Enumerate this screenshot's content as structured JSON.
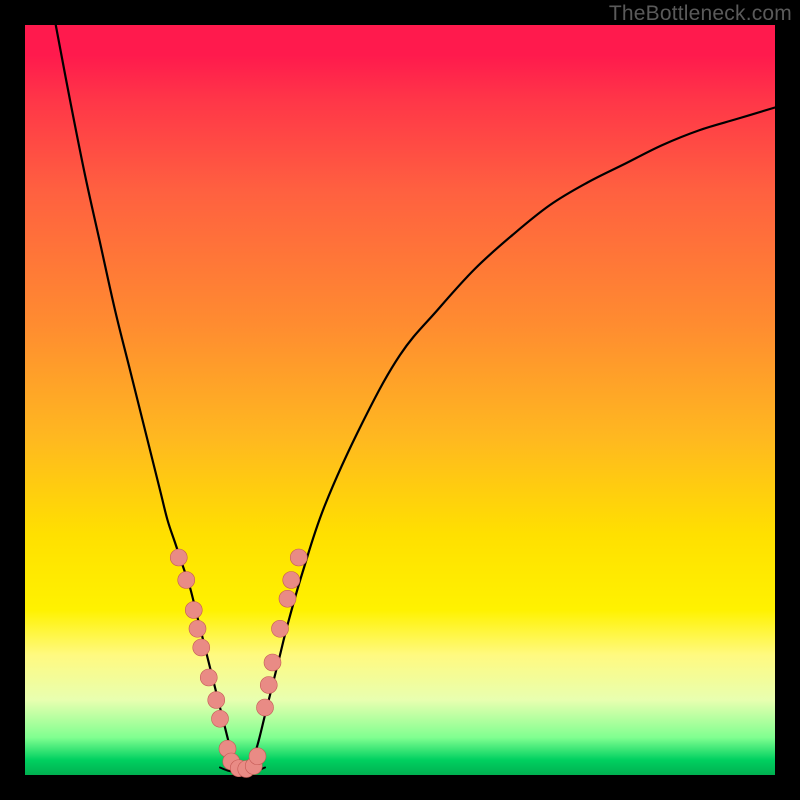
{
  "watermark": "TheBottleneck.com",
  "chart_data": {
    "type": "line",
    "title": "",
    "xlabel": "",
    "ylabel": "",
    "xlim": [
      0,
      100
    ],
    "ylim": [
      0,
      100
    ],
    "grid": false,
    "gradient_stops": [
      {
        "offset": 0,
        "color": "#ff1a4d"
      },
      {
        "offset": 4,
        "color": "#ff1a4d"
      },
      {
        "offset": 10,
        "color": "#ff3648"
      },
      {
        "offset": 22,
        "color": "#ff6040"
      },
      {
        "offset": 40,
        "color": "#ff8c30"
      },
      {
        "offset": 55,
        "color": "#ffb820"
      },
      {
        "offset": 68,
        "color": "#ffe000"
      },
      {
        "offset": 78,
        "color": "#fff200"
      },
      {
        "offset": 84,
        "color": "#fffa80"
      },
      {
        "offset": 90,
        "color": "#e8ffb0"
      },
      {
        "offset": 95,
        "color": "#80ff90"
      },
      {
        "offset": 98,
        "color": "#00d060"
      },
      {
        "offset": 100,
        "color": "#00b050"
      }
    ],
    "series": [
      {
        "name": "left-curve",
        "x": [
          4.1,
          6,
          8,
          10,
          12,
          14,
          16,
          18,
          19,
          20,
          21,
          22,
          23,
          24,
          25,
          26,
          27,
          28
        ],
        "y": [
          100,
          90,
          80,
          71,
          62,
          54,
          46,
          38,
          34,
          31,
          28,
          25,
          21,
          17,
          13,
          9,
          5,
          1
        ]
      },
      {
        "name": "right-curve",
        "x": [
          30,
          31,
          32,
          33,
          34,
          35,
          37,
          40,
          45,
          50,
          55,
          60,
          65,
          70,
          75,
          80,
          85,
          90,
          95,
          100
        ],
        "y": [
          1,
          4,
          8,
          12,
          16,
          20,
          27,
          36,
          47,
          56,
          62,
          67.5,
          72,
          76,
          79,
          81.5,
          84,
          86,
          87.5,
          89
        ]
      },
      {
        "name": "valley-floor",
        "x": [
          26,
          27,
          28,
          29,
          30,
          31,
          32
        ],
        "y": [
          1,
          0.6,
          0.4,
          0.3,
          0.4,
          0.6,
          1
        ]
      }
    ],
    "markers": [
      {
        "x": 20.5,
        "y": 29
      },
      {
        "x": 21.5,
        "y": 26
      },
      {
        "x": 22.5,
        "y": 22
      },
      {
        "x": 23,
        "y": 19.5
      },
      {
        "x": 23.5,
        "y": 17
      },
      {
        "x": 24.5,
        "y": 13
      },
      {
        "x": 25.5,
        "y": 10
      },
      {
        "x": 26,
        "y": 7.5
      },
      {
        "x": 27,
        "y": 3.5
      },
      {
        "x": 27.5,
        "y": 1.8
      },
      {
        "x": 28.5,
        "y": 0.9
      },
      {
        "x": 29.5,
        "y": 0.8
      },
      {
        "x": 30.5,
        "y": 1.2
      },
      {
        "x": 31,
        "y": 2.5
      },
      {
        "x": 32,
        "y": 9
      },
      {
        "x": 32.5,
        "y": 12
      },
      {
        "x": 33,
        "y": 15
      },
      {
        "x": 34,
        "y": 19.5
      },
      {
        "x": 35,
        "y": 23.5
      },
      {
        "x": 35.5,
        "y": 26
      },
      {
        "x": 36.5,
        "y": 29
      }
    ]
  }
}
